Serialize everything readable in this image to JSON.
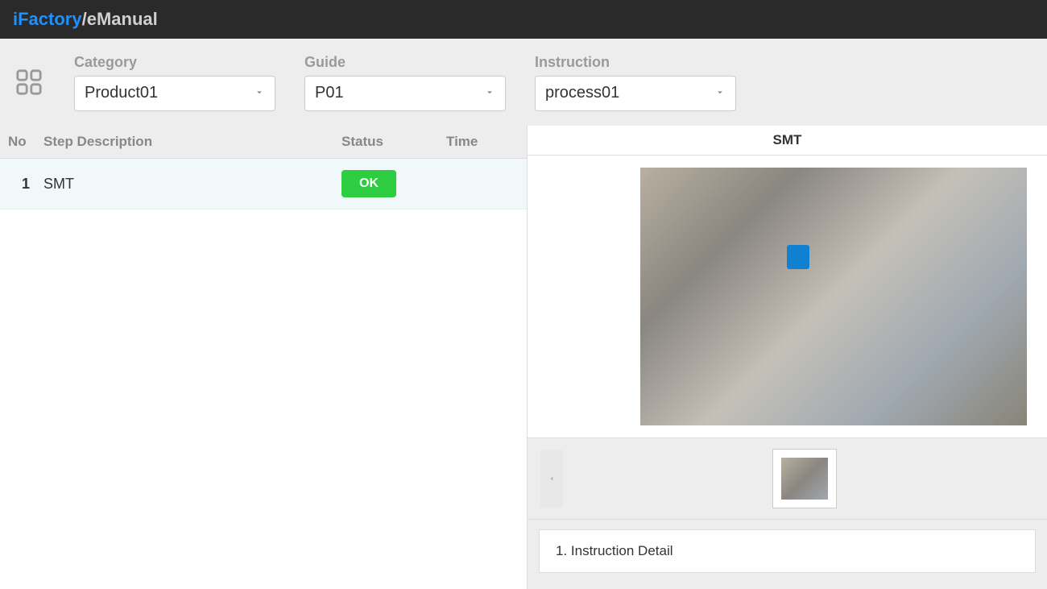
{
  "brand": {
    "part1": "iFactory",
    "sep": "/",
    "part2": "eManual"
  },
  "filters": {
    "category": {
      "label": "Category",
      "value": "Product01"
    },
    "guide": {
      "label": "Guide",
      "value": "P01"
    },
    "instruction": {
      "label": "Instruction",
      "value": "process01"
    }
  },
  "table": {
    "headers": {
      "no": "No",
      "desc": "Step Description",
      "status": "Status",
      "time": "Time"
    },
    "rows": [
      {
        "no": "1",
        "desc": "SMT",
        "status": "OK",
        "time": ""
      }
    ]
  },
  "detail": {
    "title": "SMT",
    "instruction_heading": "1. Instruction Detail"
  }
}
